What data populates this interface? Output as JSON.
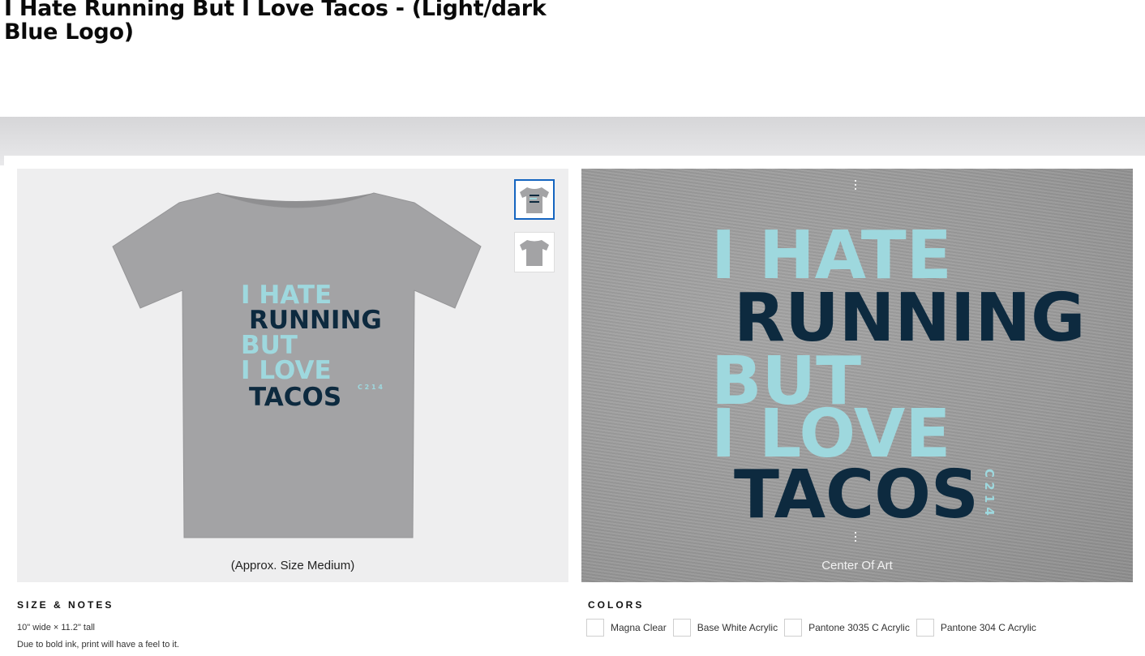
{
  "page": {
    "title": "I Hate Running But I Love Tacos - (Light/dark Blue Logo)"
  },
  "design": {
    "lines": [
      {
        "text": "I HATE",
        "tone": "light"
      },
      {
        "text": "RUNNING",
        "tone": "dark"
      },
      {
        "text": "BUT",
        "tone": "light"
      },
      {
        "text": "I LOVE",
        "tone": "light"
      },
      {
        "text": "TACOS",
        "tone": "dark"
      }
    ],
    "side_mark": "C 2 1 4",
    "colors": {
      "light": "#9ed8de",
      "dark": "#0d2a3f",
      "shirt": "#a0a0a0"
    }
  },
  "preview": {
    "caption": "(Approx. Size Medium)"
  },
  "closeup": {
    "caption": "Center Of Art"
  },
  "thumbnails": [
    {
      "label": "front view",
      "selected": true
    },
    {
      "label": "back view",
      "selected": false
    }
  ],
  "size_notes": {
    "heading": "SIZE & NOTES",
    "dimensions": "10\" wide × 11.2\" tall",
    "note": "Due to bold ink, print will have a feel to it."
  },
  "colors_section": {
    "heading": "COLORS",
    "items": [
      "Magna Clear",
      "Base White Acrylic",
      "Pantone 3035 C Acrylic",
      "Pantone 304 C Acrylic"
    ]
  },
  "accent": "#1565c0"
}
